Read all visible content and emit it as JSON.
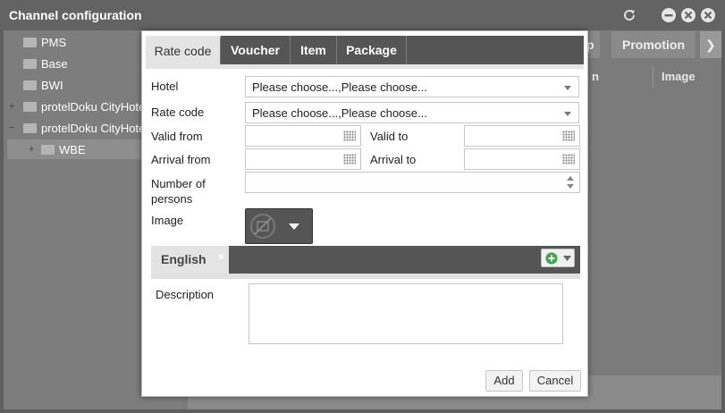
{
  "window": {
    "title": "Channel configuration"
  },
  "tree": {
    "items": [
      {
        "label": "PMS"
      },
      {
        "label": "Base"
      },
      {
        "label": "BWI"
      },
      {
        "label": "protelDoku CityHotel"
      },
      {
        "label": "protelDoku CityHotel"
      },
      {
        "label": "WBE"
      }
    ]
  },
  "background_tabs": {
    "partial_label": "p",
    "promotion_label": "Promotion",
    "next_arrow": "❯"
  },
  "background_columns": {
    "col1": "n",
    "col2": "Image"
  },
  "modal": {
    "tabs": [
      {
        "label": "Rate code",
        "active": true
      },
      {
        "label": "Voucher",
        "active": false
      },
      {
        "label": "Item",
        "active": false
      },
      {
        "label": "Package",
        "active": false
      }
    ],
    "hotel_label": "Hotel",
    "hotel_value": "Please choose...,Please choose...",
    "ratecode_label": "Rate code",
    "ratecode_value": "Please choose...,Please choose...",
    "valid_from_label": "Valid from",
    "valid_to_label": "Valid to",
    "arrival_from_label": "Arrival from",
    "arrival_to_label": "Arrival to",
    "persons_label_line1": "Number of",
    "persons_label_line2": "persons",
    "image_label": "Image",
    "language_tab": "English",
    "language_close": "×",
    "description_label": "Description",
    "add_button": "Add",
    "cancel_button": "Cancel"
  },
  "colors": {
    "header_bg": "#636363",
    "tab_bar": "#555555",
    "tab_active": "#e4e4e4",
    "add_icon_green": "#3aa84a"
  },
  "icons": [
    "refresh-icon",
    "minimize-icon",
    "restore-icon",
    "close-icon",
    "folder-icon",
    "calendar-icon",
    "spinner-icon",
    "no-image-icon",
    "add-circle-icon",
    "chevron-down-icon"
  ]
}
